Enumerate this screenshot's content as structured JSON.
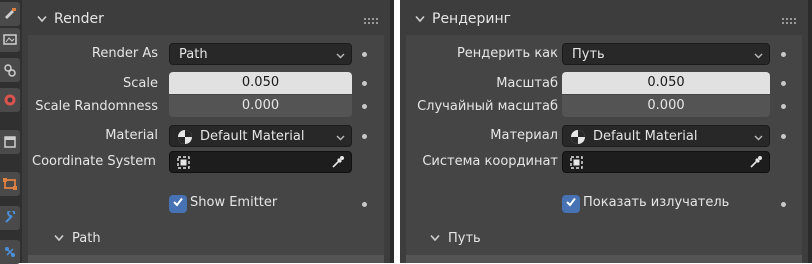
{
  "left": {
    "title": "Render",
    "render_as": {
      "label": "Render As",
      "value": "Path"
    },
    "scale": {
      "label": "Scale",
      "value": "0.050"
    },
    "scale_randomness": {
      "label": "Scale Randomness",
      "value": "0.000"
    },
    "material": {
      "label": "Material",
      "value": "Default Material"
    },
    "coordinate_system": {
      "label": "Coordinate System"
    },
    "show_emitter": {
      "label": "Show Emitter",
      "checked": true
    },
    "subpanel": "Path"
  },
  "right": {
    "title": "Рендеринг",
    "render_as": {
      "label": "Рендерить как",
      "value": "Путь"
    },
    "scale": {
      "label": "Масштаб",
      "value": "0.050"
    },
    "scale_randomness": {
      "label": "Случайный масштаб",
      "value": "0.000"
    },
    "material": {
      "label": "Материал",
      "value": "Default Material"
    },
    "coordinate_system": {
      "label": "Система координат"
    },
    "show_emitter": {
      "label": "Показать излучатель",
      "checked": true
    },
    "subpanel": "Путь"
  },
  "colors": {
    "accent": "#4772b3",
    "panel": "#3d3d3d",
    "field": "#545454"
  },
  "icons": [
    "chevron-down-icon",
    "grip-icon",
    "material-sphere-icon",
    "object-icon",
    "eyedropper-icon",
    "checkmark-icon"
  ]
}
